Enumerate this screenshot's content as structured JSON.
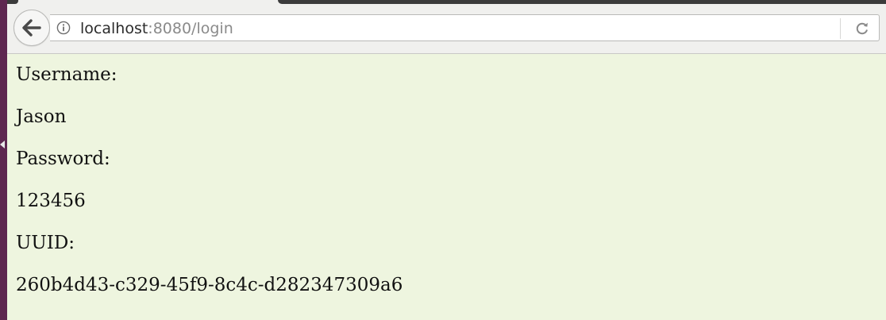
{
  "browser": {
    "url_host": "localhost",
    "url_rest": ":8080/login",
    "icons": {
      "back": "back-arrow-icon",
      "info": "info-icon",
      "reload": "reload-icon"
    }
  },
  "page": {
    "username_label": "Username:",
    "username_value": "Jason",
    "password_label": "Password:",
    "password_value": "123456",
    "uuid_label": "UUID:",
    "uuid_value": "260b4d43-c329-45f9-8c4c-d282347309a6",
    "background_color": "#eef5df"
  }
}
